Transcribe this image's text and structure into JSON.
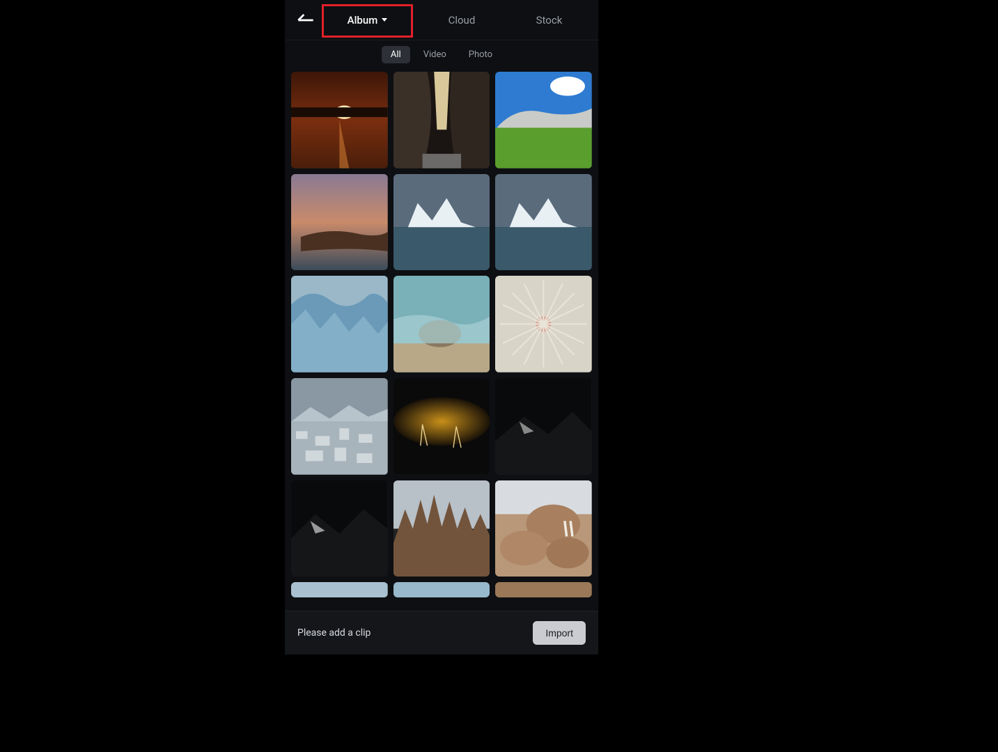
{
  "header": {
    "tabs": [
      {
        "label": "Album",
        "active": true,
        "hasDropdown": true
      },
      {
        "label": "Cloud",
        "active": false
      },
      {
        "label": "Stock",
        "active": false
      }
    ]
  },
  "filters": [
    {
      "label": "All",
      "active": true
    },
    {
      "label": "Video",
      "active": false
    },
    {
      "label": "Photo",
      "active": false
    }
  ],
  "thumbnails": [
    {
      "name": "sunset-over-water"
    },
    {
      "name": "canyon-slot"
    },
    {
      "name": "mountain-green-meadow"
    },
    {
      "name": "coastal-aerial-dusk"
    },
    {
      "name": "iceberg-1"
    },
    {
      "name": "iceberg-2"
    },
    {
      "name": "blue-glacier"
    },
    {
      "name": "seal-in-water"
    },
    {
      "name": "dandelion-macro"
    },
    {
      "name": "icy-landscape"
    },
    {
      "name": "lightning-night"
    },
    {
      "name": "dark-mountain-1"
    },
    {
      "name": "dark-mountain-2"
    },
    {
      "name": "rocky-peaks"
    },
    {
      "name": "walrus-group"
    },
    {
      "name": "partial-1"
    },
    {
      "name": "partial-2"
    },
    {
      "name": "partial-3"
    }
  ],
  "bottom": {
    "hint": "Please add a clip",
    "import_label": "Import"
  },
  "annotation": {
    "highlight_target": "album-tab"
  }
}
